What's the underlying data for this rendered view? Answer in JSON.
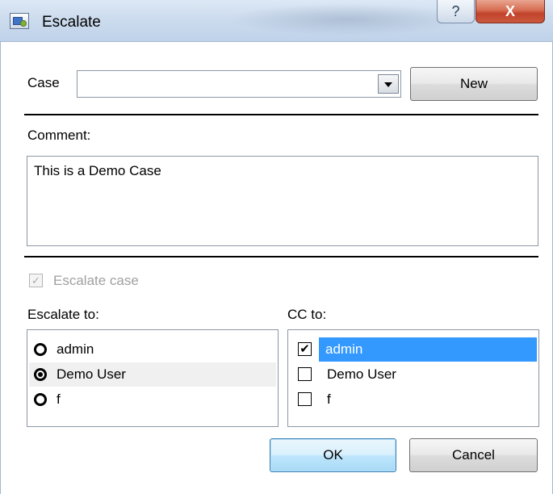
{
  "window": {
    "title": "Escalate",
    "help_label": "?",
    "close_label": "X"
  },
  "case": {
    "label": "Case",
    "value": "",
    "new_label": "New"
  },
  "comment": {
    "label": "Comment:",
    "value": "This is a Demo Case"
  },
  "escalate_case": {
    "label": "Escalate case",
    "checked": true,
    "check_glyph": "✓"
  },
  "escalate_to": {
    "label": "Escalate to:",
    "items": [
      {
        "label": "admin",
        "selected": false
      },
      {
        "label": "Demo User",
        "selected": true
      },
      {
        "label": "f",
        "selected": false
      }
    ]
  },
  "cc_to": {
    "label": "CC to:",
    "check_glyph": "✔",
    "items": [
      {
        "label": "admin",
        "checked": true
      },
      {
        "label": "Demo User",
        "checked": false
      },
      {
        "label": "f",
        "checked": false
      }
    ]
  },
  "buttons": {
    "ok_label": "OK",
    "cancel_label": "Cancel"
  },
  "colors": {
    "selection": "#3399ff",
    "close_button": "#c2432b"
  },
  "icons": {
    "app": "escalate-app-icon",
    "dropdown": "chevron-down-icon",
    "radio": "radio-icon",
    "checkbox": "checkbox-icon"
  }
}
